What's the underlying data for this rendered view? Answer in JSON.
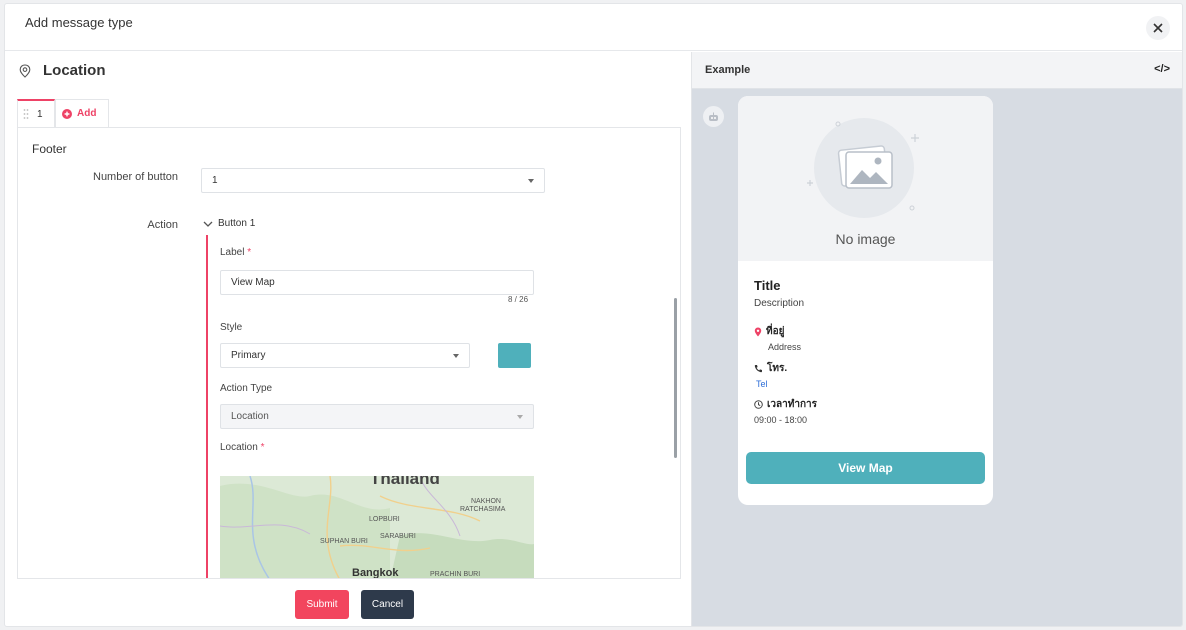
{
  "modal": {
    "title": "Add message type"
  },
  "section": {
    "title": "Location",
    "icon": "location-pin-icon"
  },
  "tabs": [
    {
      "label": "1"
    },
    {
      "label": "Add"
    }
  ],
  "form": {
    "footer_label": "Footer",
    "number_of_button": {
      "label": "Number of button",
      "value": "1"
    },
    "action": {
      "label": "Action",
      "button_group_title": "Button 1",
      "label_field": {
        "label": "Label",
        "required_mark": "*",
        "value": "View Map",
        "counter": "8 / 26"
      },
      "style_field": {
        "label": "Style",
        "value": "Primary",
        "color": "#4fb0bb"
      },
      "action_type_field": {
        "label": "Action Type",
        "value": "Location"
      },
      "location_field": {
        "label": "Location",
        "required_mark": "*",
        "map_labels": [
          "Thailand",
          "NAKHON RATCHASIMA",
          "LOPBURI",
          "SARABURI",
          "SUPHAN BURI",
          "Bangkok",
          "PRACHIN BURI"
        ]
      }
    }
  },
  "actions": {
    "submit": "Submit",
    "cancel": "Cancel"
  },
  "example": {
    "title": "Example",
    "code_icon_label": "</>",
    "card": {
      "no_image": "No image",
      "title": "Title",
      "description": "Description",
      "address_label": "ที่อยู่",
      "address_value": "Address",
      "tel_label": "โทร.",
      "tel_value": "Tel",
      "hours_label": "เวลาทำการ",
      "hours_value": "09:00 - 18:00",
      "button": "View Map"
    }
  },
  "colors": {
    "accent_red": "#ee4266",
    "primary_teal": "#4fb0bb",
    "cancel_dark": "#2e3a4b",
    "tel_blue": "#2f6fd8"
  }
}
